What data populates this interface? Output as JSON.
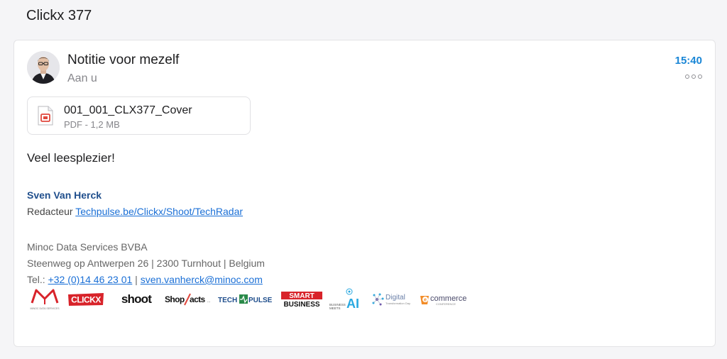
{
  "thread": {
    "title": "Clickx 377"
  },
  "message": {
    "subject": "Notitie voor mezelf",
    "recipient": "Aan u",
    "time": "15:40",
    "more_icon": "more-icon",
    "body": "Veel leesplezier!"
  },
  "attachment": {
    "name": "001_001_CLX377_Cover",
    "meta": "PDF - 1,2 MB",
    "icon": "pdf-file-icon"
  },
  "signature": {
    "name": "Sven Van Herck",
    "role_prefix": "Redacteur ",
    "role_link": "Techpulse.be/Clickx/Shoot/TechRadar",
    "company": "Minoc Data Services BVBA",
    "address": "Steenweg op Antwerpen 26 | 2300 Turnhout | Belgium",
    "tel_prefix": "Tel.: ",
    "tel_link": "+32 (0)14 46 23 01",
    "tel_separator": " | ",
    "email_link": "sven.vanherck@minoc.com",
    "logos": {
      "minoc": "MINOC DATA SERVICES",
      "clickx": "CLICKX",
      "shoot": "shoot",
      "shopfacts": "ShopFacts",
      "techpulse": "TECHPULSE",
      "smart_business_1": "SMART",
      "smart_business_2": "BUSINESS",
      "business_meets_ai": "AI",
      "digital": "Digital",
      "ecommerce": "ecommerce"
    }
  },
  "colors": {
    "accent": "#1a86d6",
    "signature_name": "#1f4e8c",
    "link": "#1a6fd6",
    "pdf_red": "#e0483e"
  }
}
